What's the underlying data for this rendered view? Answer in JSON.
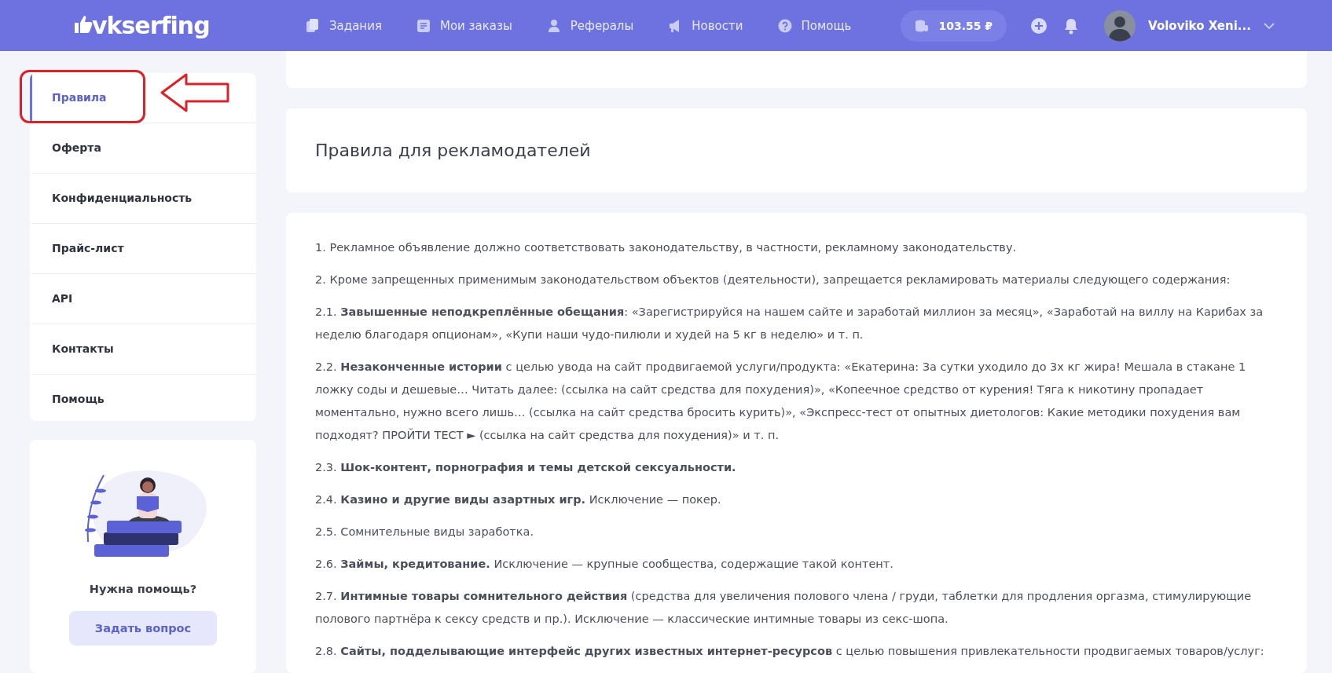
{
  "header": {
    "logo": "vkserfing",
    "nav": [
      {
        "label": "Задания",
        "kind": "tasks"
      },
      {
        "label": "Мои заказы",
        "kind": "orders"
      },
      {
        "label": "Рефералы",
        "kind": "referrals"
      },
      {
        "label": "Новости",
        "kind": "news"
      },
      {
        "label": "Помощь",
        "kind": "help"
      }
    ],
    "balance": "103.55 ₽",
    "user": "Voloviko Xeni..."
  },
  "sidebar": {
    "items": [
      {
        "label": "Правила",
        "selected": true
      },
      {
        "label": "Оферта",
        "selected": false
      },
      {
        "label": "Конфиденциальность",
        "selected": false
      },
      {
        "label": "Прайс-лист",
        "selected": false
      },
      {
        "label": "API",
        "selected": false
      },
      {
        "label": "Контакты",
        "selected": false
      },
      {
        "label": "Помощь",
        "selected": false
      }
    ],
    "help_card": {
      "title": "Нужна помощь?",
      "button": "Задать вопрос"
    }
  },
  "content": {
    "title": "Правила для рекламодателей",
    "paragraphs": [
      "1. Рекламное объявление должно соответствовать законодательству, в частности, рекламному законодательству.",
      "2. Кроме запрещенных применимым законодательством объектов (деятельности), запрещается рекламировать материалы следующего содержания:",
      "2.1. **Завышенные неподкреплённые обещания**: «Зарегистрируйся на нашем сайте и заработай миллион за месяц», «Заработай на виллу на Карибах за неделю благодаря опционам», «Купи наши чудо-пилюли и худей на 5 кг в неделю» и т. п.",
      "2.2. **Незаконченные истории** с целью увода на сайт продвигаемой услуги/продукта: «Екатерина: За сутки уходило до 3х кг жира! Мешала в стакане 1 ложку соды и дешевые… Читать далее: (ссылка на сайт средства для похудения)», «Копеечное средство от курения! Тяга к никотину пропадает моментально, нужно всего лишь… (ссылка на сайт средства бросить курить)», «Экспресс-тест от опытных диетологов: Какие методики похудения вам подходят? ПРОЙТИ ТЕСТ ► (ссылка на сайт средства для похудения)» и т. п.",
      "2.3. **Шок-контент, порнография и темы детской сексуальности.**",
      "2.4. **Казино и другие виды азартных игр.** Исключение — покер.",
      "2.5. Сомнительные виды заработка.",
      "2.6. **Займы, кредитование.** Исключение — крупные сообщества, содержащие такой контент.",
      "2.7. **Интимные товары сомнительного действия** (средства для увеличения полового члена / груди, таблетки для продления оргазма, стимулирующие полового партнёра к сексу средств и пр.). Исключение — классические интимные товары из секс-шопа.",
      "2.8. **Сайты, подделывающие интерфейс других известных интернет-ресурсов** с целью повышения привлекательности продвигаемых товаров/услуг:"
    ]
  }
}
